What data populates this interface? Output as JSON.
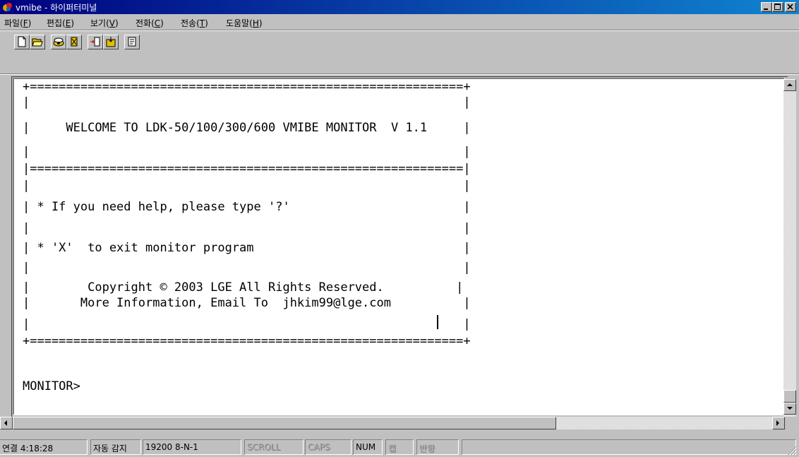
{
  "window": {
    "title": "vmibe - 하이퍼터미널",
    "icon": "hyperterminal-icon"
  },
  "menu": [
    {
      "label": "파일(",
      "key": "F",
      "suffix": ")"
    },
    {
      "label": "편집(",
      "key": "E",
      "suffix": ")"
    },
    {
      "label": "보기(",
      "key": "V",
      "suffix": ")"
    },
    {
      "label": "전화(",
      "key": "C",
      "suffix": ")"
    },
    {
      "label": "전송(",
      "key": "T",
      "suffix": ")"
    },
    {
      "label": "도움말(",
      "key": "H",
      "suffix": ")"
    }
  ],
  "toolbar": {
    "icons": [
      "new-file-icon",
      "open-folder-icon",
      "dial-icon",
      "disconnect-icon",
      "send-file-icon",
      "receive-file-icon",
      "properties-icon"
    ]
  },
  "terminal": {
    "lines": [
      "+============================================================+",
      "|                                                            |",
      "|     WELCOME TO LDK-50/100/300/600 VMIBE MONITOR  V 1.1     |",
      "|                                                            |",
      "|============================================================|",
      "|                                                            |",
      "| * If you need help, please type '?'                        |",
      "|                                                            |",
      "| * 'X'  to exit monitor program                             |",
      "|                                                            |",
      "|        Copyright © 2003 LGE All Rights Reserved.          |",
      "|       More Information, Email To  jhkim99@lge.com          |",
      "|                                                            |",
      "+============================================================+",
      "",
      "MONITOR>"
    ]
  },
  "status": {
    "connection": "연결 4:18:28",
    "detect": "자동 감지",
    "port_settings": "19200 8-N-1",
    "scroll": "SCROLL",
    "caps": "CAPS",
    "num": "NUM",
    "capture": "캡",
    "echo": "반향"
  }
}
